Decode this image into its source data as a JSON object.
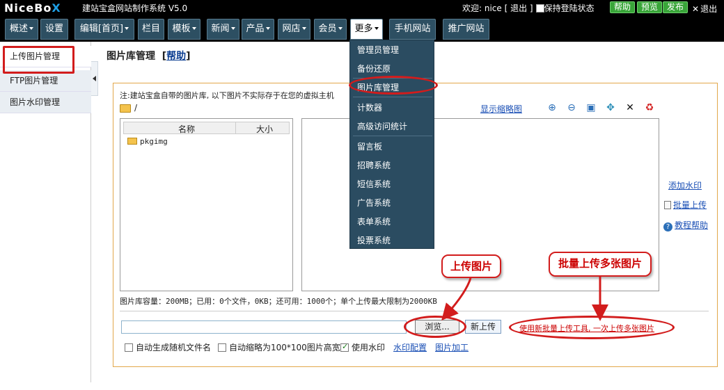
{
  "header": {
    "logo_main": "NiceBo",
    "logo_x": "X",
    "system_title": "建站宝盒网站制作系统 V5.0",
    "welcome": "欢迎: nice [ 退出 ]",
    "keep_login": "保持登陆状态",
    "buttons": {
      "help": "帮助",
      "preview": "预览",
      "publish": "发布"
    },
    "exit": "退出"
  },
  "nav": [
    {
      "label": "概述",
      "dropdown": true
    },
    {
      "label": "设置",
      "dropdown": false
    },
    {
      "label": "编辑[首页]",
      "dropdown": true
    },
    {
      "label": "栏目",
      "dropdown": false
    },
    {
      "label": "模板",
      "dropdown": true
    },
    {
      "label": "新闻",
      "dropdown": true
    },
    {
      "label": "产品",
      "dropdown": true
    },
    {
      "label": "网店",
      "dropdown": true
    },
    {
      "label": "会员",
      "dropdown": true
    },
    {
      "label": "更多",
      "dropdown": true
    },
    {
      "label": "手机网站",
      "dropdown": false
    },
    {
      "label": "推广网站",
      "dropdown": false
    }
  ],
  "sidebar": {
    "items": [
      "上传图片管理",
      "FTP图片管理",
      "图片水印管理"
    ]
  },
  "main": {
    "title": "图片库管理",
    "help_link": "帮助",
    "note": "注:建站宝盒自带的图片库, 以下图片不实际存于在您的虚拟主机",
    "path": "/",
    "thumb_link": "显示缩略图",
    "tools": [
      "zoom-in-icon",
      "zoom-out-icon",
      "fit-icon",
      "move-icon",
      "delete-icon",
      "recycle-icon"
    ],
    "list_headers": {
      "name": "名称",
      "size": "大小"
    },
    "folders": [
      "pkgimg"
    ],
    "side_links": {
      "watermark": "添加水印",
      "batch": "批量上传",
      "tutorial": "教程帮助"
    },
    "capacity": "图片库容量：200MB；已用：0个文件，0KB；还可用：1000个；单个上传最大限制为2000KB",
    "browse": "浏览...",
    "new_upload": "新上传",
    "batch_tool": "使用新批量上传工具, 一次上传多张图片",
    "options": {
      "random_name": "自动生成随机文件名",
      "auto_thumb": "自动缩略为100*100图片高宽",
      "use_watermark": "使用水印",
      "watermark_config": "水印配置",
      "image_process": "图片加工"
    }
  },
  "dropdown_menu": {
    "items": [
      "管理员管理",
      "备份还原",
      "图片库管理",
      "计数器",
      "高级访问统计",
      "留言板",
      "招聘系统",
      "短信系统",
      "广告系统",
      "表单系统",
      "投票系统"
    ]
  },
  "annotations": {
    "upload_image": "上传图片",
    "batch_upload": "批量上传多张图片"
  },
  "colors": {
    "topbar": "#000000",
    "nav": "#2d4f62",
    "accent_green": "#39a539",
    "annotation_red": "#d21c1c",
    "panel_border": "#e2a74a",
    "link": "#1a4fb5"
  }
}
